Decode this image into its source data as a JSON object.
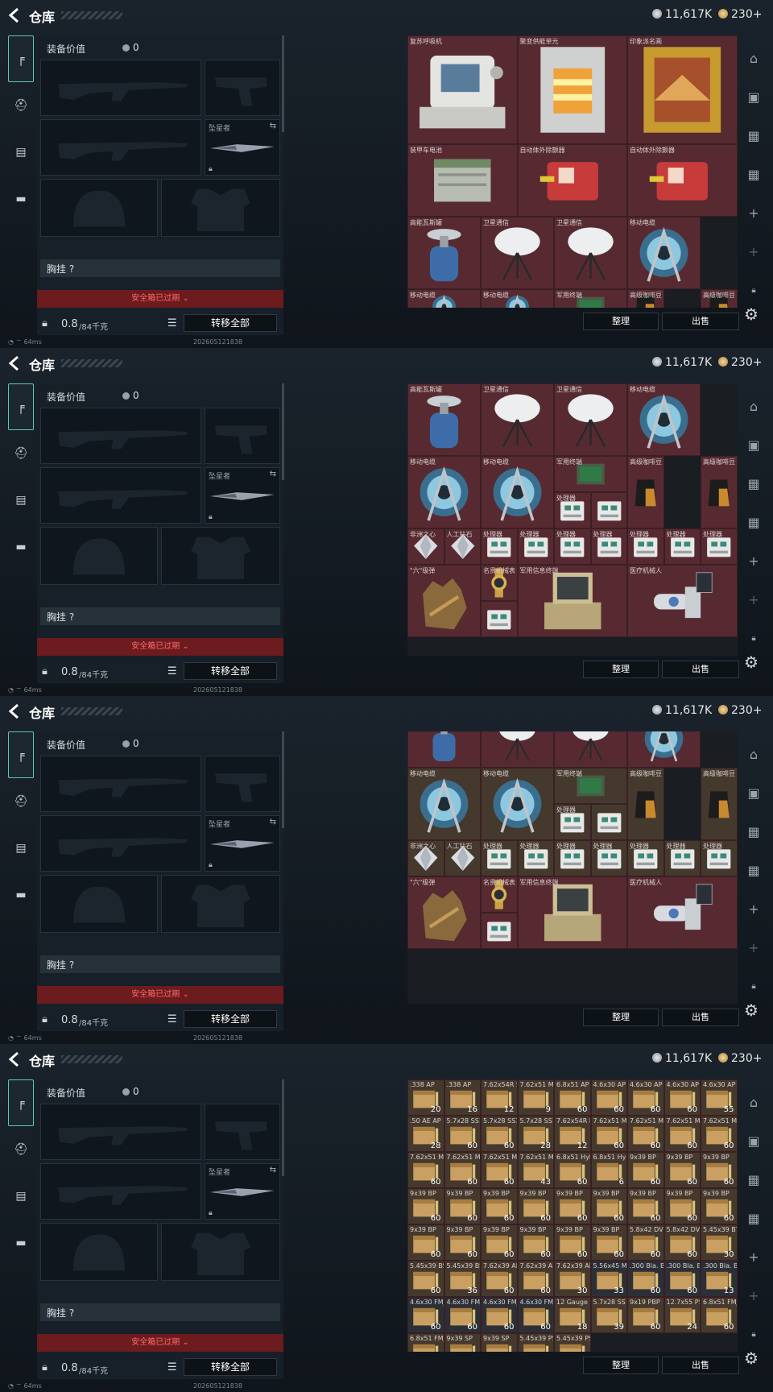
{
  "header": {
    "title": "仓库",
    "currency1": "11,617K",
    "currency2": "230+"
  },
  "gear": {
    "value_label": "装备价值",
    "value": "0",
    "melee_title": "坠星者",
    "chest_label": "胸挂",
    "chest_value": "?",
    "safe_box": "安全箱已过期",
    "weight": "0.8",
    "weight_cap": "/84千克",
    "transfer": "转移全部"
  },
  "buttons": {
    "sort": "整理",
    "sell": "出售"
  },
  "status": {
    "ping": "64ms",
    "build": "202605121838"
  },
  "panels": [
    {
      "cells": [
        {
          "r": 0,
          "c": 0,
          "w": 3,
          "h": 3,
          "name": "复苏呼吸机",
          "icon": "respirator-icon",
          "bg": "red"
        },
        {
          "r": 0,
          "c": 3,
          "w": 3,
          "h": 3,
          "name": "聚变供能单元",
          "icon": "fusion-unit-icon",
          "bg": "red"
        },
        {
          "r": 0,
          "c": 6,
          "w": 3,
          "h": 3,
          "name": "印象派名画",
          "icon": "painting-icon",
          "bg": "red"
        },
        {
          "r": 3,
          "c": 0,
          "w": 3,
          "h": 2,
          "name": "装甲车电池",
          "icon": "battery-icon",
          "bg": "red"
        },
        {
          "r": 3,
          "c": 3,
          "w": 3,
          "h": 2,
          "name": "自动体外除颤器",
          "icon": "defibrillator-icon",
          "bg": "red"
        },
        {
          "r": 3,
          "c": 6,
          "w": 3,
          "h": 2,
          "name": "自动体外除颤器",
          "icon": "defibrillator-icon",
          "bg": "red"
        },
        {
          "r": 5,
          "c": 0,
          "w": 2,
          "h": 2,
          "name": "高能瓦斯罐",
          "icon": "gas-tank-icon",
          "bg": "red"
        },
        {
          "r": 5,
          "c": 2,
          "w": 2,
          "h": 2,
          "name": "卫星通信",
          "icon": "satellite-dish-icon",
          "bg": "red"
        },
        {
          "r": 5,
          "c": 4,
          "w": 2,
          "h": 2,
          "name": "卫星通信",
          "icon": "satellite-dish-icon",
          "bg": "red"
        },
        {
          "r": 5,
          "c": 6,
          "w": 2,
          "h": 2,
          "name": "移动电缆",
          "icon": "cable-reel-icon",
          "bg": "red"
        },
        {
          "r": 7,
          "c": 0,
          "w": 2,
          "h": 1,
          "name": "移动电缆",
          "icon": "cable-reel-icon",
          "bg": "red"
        },
        {
          "r": 7,
          "c": 2,
          "w": 2,
          "h": 1,
          "name": "移动电缆",
          "icon": "cable-reel-icon",
          "bg": "red"
        },
        {
          "r": 7,
          "c": 4,
          "w": 2,
          "h": 1,
          "name": "军用终端",
          "icon": "terminal-icon",
          "bg": "red"
        },
        {
          "r": 7,
          "c": 6,
          "w": 1,
          "h": 1,
          "name": "高级咖啡豆",
          "icon": "coffee-icon",
          "bg": "red"
        },
        {
          "r": 7,
          "c": 8,
          "w": 1,
          "h": 1,
          "name": "高级咖啡豆",
          "icon": "coffee-icon",
          "bg": "red"
        }
      ]
    },
    {
      "cells": [
        {
          "r": 0,
          "c": 0,
          "w": 2,
          "h": 2,
          "name": "高能瓦斯罐",
          "icon": "gas-tank-icon",
          "bg": "red"
        },
        {
          "r": 0,
          "c": 2,
          "w": 2,
          "h": 2,
          "name": "卫星通信",
          "icon": "satellite-dish-icon",
          "bg": "red"
        },
        {
          "r": 0,
          "c": 4,
          "w": 2,
          "h": 2,
          "name": "卫星通信",
          "icon": "satellite-dish-icon",
          "bg": "red"
        },
        {
          "r": 0,
          "c": 6,
          "w": 2,
          "h": 2,
          "name": "移动电缆",
          "icon": "cable-reel-icon",
          "bg": "red"
        },
        {
          "r": 2,
          "c": 0,
          "w": 2,
          "h": 2,
          "name": "移动电缆",
          "icon": "cable-reel-icon",
          "bg": "red"
        },
        {
          "r": 2,
          "c": 2,
          "w": 2,
          "h": 2,
          "name": "移动电缆",
          "icon": "cable-reel-icon",
          "bg": "red"
        },
        {
          "r": 2,
          "c": 4,
          "w": 2,
          "h": 1,
          "name": "军用终端",
          "icon": "terminal-icon",
          "bg": "red"
        },
        {
          "r": 2,
          "c": 6,
          "w": 1,
          "h": 2,
          "name": "高级咖啡豆",
          "icon": "coffee-icon",
          "bg": "red"
        },
        {
          "r": 2,
          "c": 8,
          "w": 1,
          "h": 2,
          "name": "高级咖啡豆",
          "icon": "coffee-icon",
          "bg": "red"
        },
        {
          "r": 3,
          "c": 4,
          "w": 1,
          "h": 1,
          "name": "处理器",
          "icon": "processor-icon",
          "bg": "red"
        },
        {
          "r": 3,
          "c": 5,
          "w": 1,
          "h": 1,
          "name": "",
          "icon": "processor-icon",
          "bg": "red"
        },
        {
          "r": 4,
          "c": 0,
          "w": 1,
          "h": 1,
          "name": "非洲之心",
          "icon": "diamond-icon",
          "bg": "red"
        },
        {
          "r": 4,
          "c": 1,
          "w": 1,
          "h": 1,
          "name": "人工钻石",
          "icon": "diamond-icon",
          "bg": "red"
        },
        {
          "r": 4,
          "c": 2,
          "w": 1,
          "h": 1,
          "name": "处理器",
          "icon": "processor-icon",
          "bg": "red"
        },
        {
          "r": 4,
          "c": 3,
          "w": 1,
          "h": 1,
          "name": "处理器",
          "icon": "processor-icon",
          "bg": "red"
        },
        {
          "r": 4,
          "c": 4,
          "w": 1,
          "h": 1,
          "name": "处理器",
          "icon": "processor-icon",
          "bg": "red"
        },
        {
          "r": 4,
          "c": 5,
          "w": 1,
          "h": 1,
          "name": "处理器",
          "icon": "processor-icon",
          "bg": "red"
        },
        {
          "r": 4,
          "c": 6,
          "w": 1,
          "h": 1,
          "name": "处理器",
          "icon": "processor-icon",
          "bg": "red"
        },
        {
          "r": 4,
          "c": 7,
          "w": 1,
          "h": 1,
          "name": "处理器",
          "icon": "processor-icon",
          "bg": "red"
        },
        {
          "r": 4,
          "c": 8,
          "w": 1,
          "h": 1,
          "name": "处理器",
          "icon": "processor-icon",
          "bg": "red"
        },
        {
          "r": 5,
          "c": 0,
          "w": 2,
          "h": 2,
          "name": "\"六\"级弹",
          "icon": "glove-icon",
          "bg": "red"
        },
        {
          "r": 5,
          "c": 2,
          "w": 1,
          "h": 1,
          "name": "名贵机械表",
          "icon": "watch-icon",
          "bg": "red"
        },
        {
          "r": 6,
          "c": 2,
          "w": 1,
          "h": 1,
          "name": "",
          "icon": "processor-icon",
          "bg": "red"
        },
        {
          "r": 5,
          "c": 3,
          "w": 3,
          "h": 2,
          "name": "军用信息终端",
          "icon": "laptop-case-icon",
          "bg": "red"
        },
        {
          "r": 5,
          "c": 6,
          "w": 3,
          "h": 2,
          "name": "医疗机械人",
          "icon": "robot-arm-icon",
          "bg": "red"
        }
      ]
    },
    {
      "cells": [
        {
          "r": -0.6,
          "c": 0,
          "w": 2,
          "h": 1.6,
          "name": "",
          "icon": "gas-tank-icon",
          "bg": "red"
        },
        {
          "r": -0.6,
          "c": 2,
          "w": 2,
          "h": 1.6,
          "name": "",
          "icon": "satellite-dish-icon",
          "bg": "red"
        },
        {
          "r": -0.6,
          "c": 4,
          "w": 2,
          "h": 1.6,
          "name": "",
          "icon": "satellite-dish-icon",
          "bg": "red"
        },
        {
          "r": -0.6,
          "c": 6,
          "w": 2,
          "h": 1.6,
          "name": "",
          "icon": "cable-reel-icon",
          "bg": "red"
        },
        {
          "r": 1,
          "c": 0,
          "w": 2,
          "h": 2,
          "name": "移动电缆",
          "icon": "cable-reel-icon",
          "bg": "brown"
        },
        {
          "r": 1,
          "c": 2,
          "w": 2,
          "h": 2,
          "name": "移动电缆",
          "icon": "cable-reel-icon",
          "bg": "brown"
        },
        {
          "r": 1,
          "c": 4,
          "w": 2,
          "h": 1,
          "name": "军用终端",
          "icon": "terminal-icon",
          "bg": "brown"
        },
        {
          "r": 1,
          "c": 6,
          "w": 1,
          "h": 2,
          "name": "高级咖啡豆",
          "icon": "coffee-icon",
          "bg": "brown"
        },
        {
          "r": 1,
          "c": 8,
          "w": 1,
          "h": 2,
          "name": "高级咖啡豆",
          "icon": "coffee-icon",
          "bg": "brown"
        },
        {
          "r": 2,
          "c": 4,
          "w": 1,
          "h": 1,
          "name": "处理器",
          "icon": "processor-icon",
          "bg": "brown"
        },
        {
          "r": 2,
          "c": 5,
          "w": 1,
          "h": 1,
          "name": "",
          "icon": "processor-icon",
          "bg": "brown"
        },
        {
          "r": 3,
          "c": 0,
          "w": 1,
          "h": 1,
          "name": "非洲之心",
          "icon": "diamond-icon",
          "bg": "brown"
        },
        {
          "r": 3,
          "c": 1,
          "w": 1,
          "h": 1,
          "name": "人工钻石",
          "icon": "diamond-icon",
          "bg": "brown"
        },
        {
          "r": 3,
          "c": 2,
          "w": 1,
          "h": 1,
          "name": "处理器",
          "icon": "processor-icon",
          "bg": "brown"
        },
        {
          "r": 3,
          "c": 3,
          "w": 1,
          "h": 1,
          "name": "处理器",
          "icon": "processor-icon",
          "bg": "brown"
        },
        {
          "r": 3,
          "c": 4,
          "w": 1,
          "h": 1,
          "name": "处理器",
          "icon": "processor-icon",
          "bg": "brown"
        },
        {
          "r": 3,
          "c": 5,
          "w": 1,
          "h": 1,
          "name": "处理器",
          "icon": "processor-icon",
          "bg": "brown"
        },
        {
          "r": 3,
          "c": 6,
          "w": 1,
          "h": 1,
          "name": "处理器",
          "icon": "processor-icon",
          "bg": "brown"
        },
        {
          "r": 3,
          "c": 7,
          "w": 1,
          "h": 1,
          "name": "处理器",
          "icon": "processor-icon",
          "bg": "brown"
        },
        {
          "r": 3,
          "c": 8,
          "w": 1,
          "h": 1,
          "name": "处理器",
          "icon": "processor-icon",
          "bg": "brown"
        },
        {
          "r": 4,
          "c": 0,
          "w": 2,
          "h": 2,
          "name": "\"六\"级弹",
          "icon": "glove-icon",
          "bg": "red"
        },
        {
          "r": 4,
          "c": 2,
          "w": 1,
          "h": 1,
          "name": "名贵机械表",
          "icon": "watch-icon",
          "bg": "red"
        },
        {
          "r": 5,
          "c": 2,
          "w": 1,
          "h": 1,
          "name": "",
          "icon": "processor-icon",
          "bg": "red"
        },
        {
          "r": 4,
          "c": 3,
          "w": 3,
          "h": 2,
          "name": "军用信息终端",
          "icon": "laptop-case-icon",
          "bg": "red"
        },
        {
          "r": 4,
          "c": 6,
          "w": 3,
          "h": 2,
          "name": "医疗机械人",
          "icon": "robot-arm-icon",
          "bg": "red"
        }
      ]
    },
    {
      "ammo": true,
      "cells": [
        {
          "name": ".338 AP",
          "count": "20",
          "icon": "ammo-box-icon"
        },
        {
          "name": ".338 AP",
          "count": "16",
          "icon": "ammo-box-icon"
        },
        {
          "name": "7.62x54R SNB",
          "count": "12",
          "icon": "ammo-box-icon"
        },
        {
          "name": "7.62x51 M62",
          "count": "9",
          "icon": "ammo-box-icon"
        },
        {
          "name": "6.8x51 AP",
          "count": "60",
          "icon": "ammo-box-icon"
        },
        {
          "name": "4.6x30 AP",
          "count": "60",
          "icon": "ammo-box-icon"
        },
        {
          "name": "4.6x30 AP",
          "count": "60",
          "icon": "ammo-box-icon"
        },
        {
          "name": "4.6x30 AP",
          "count": "60",
          "icon": "ammo-box-icon"
        },
        {
          "name": "4.6x30 AP",
          "count": "55",
          "icon": "ammo-box-icon"
        },
        {
          "name": ".50 AE AP",
          "count": "28",
          "icon": "ammo-box-icon"
        },
        {
          "name": "5.7x28 SS190",
          "count": "60",
          "icon": "ammo-box-icon"
        },
        {
          "name": "5.7x28 SS190",
          "count": "60",
          "icon": "ammo-box-icon"
        },
        {
          "name": "5.7x28 SS190",
          "count": "28",
          "icon": "ammo-box-icon"
        },
        {
          "name": "7.62x54R LPS",
          "count": "12",
          "icon": "ammo-box-icon"
        },
        {
          "name": "7.62x51 M61",
          "count": "60",
          "icon": "ammo-box-icon"
        },
        {
          "name": "7.62x51 M61",
          "count": "60",
          "icon": "ammo-box-icon"
        },
        {
          "name": "7.62x51 M61",
          "count": "60",
          "icon": "ammo-box-icon"
        },
        {
          "name": "7.62x51 M61",
          "count": "60",
          "icon": "ammo-box-icon"
        },
        {
          "name": "7.62x51 M80",
          "count": "60",
          "icon": "ammo-box-icon"
        },
        {
          "name": "7.62x51 M80",
          "count": "60",
          "icon": "ammo-box-icon"
        },
        {
          "name": "7.62x51 M80",
          "count": "60",
          "icon": "ammo-box-icon"
        },
        {
          "name": "7.62x51 M80",
          "count": "43",
          "icon": "ammo-box-icon"
        },
        {
          "name": "6.8x51 Hybrid",
          "count": "60",
          "icon": "ammo-box-icon"
        },
        {
          "name": "6.8x51 Hybrid",
          "count": "6",
          "icon": "ammo-box-icon"
        },
        {
          "name": "9x39 BP",
          "count": "60",
          "icon": "ammo-box-icon"
        },
        {
          "name": "9x39 BP",
          "count": "60",
          "icon": "ammo-box-icon"
        },
        {
          "name": "9x39 BP",
          "count": "60",
          "icon": "ammo-box-icon"
        },
        {
          "name": "9x39 BP",
          "count": "60",
          "icon": "ammo-box-icon"
        },
        {
          "name": "9x39 BP",
          "count": "60",
          "icon": "ammo-box-icon"
        },
        {
          "name": "9x39 BP",
          "count": "60",
          "icon": "ammo-box-icon"
        },
        {
          "name": "9x39 BP",
          "count": "60",
          "icon": "ammo-box-icon"
        },
        {
          "name": "9x39 BP",
          "count": "60",
          "icon": "ammo-box-icon"
        },
        {
          "name": "9x39 BP",
          "count": "60",
          "icon": "ammo-box-icon"
        },
        {
          "name": "9x39 BP",
          "count": "60",
          "icon": "ammo-box-icon"
        },
        {
          "name": "9x39 BP",
          "count": "60",
          "icon": "ammo-box-icon"
        },
        {
          "name": "9x39 BP",
          "count": "60",
          "icon": "ammo-box-icon"
        },
        {
          "name": "9x39 BP",
          "count": "60",
          "icon": "ammo-box-icon"
        },
        {
          "name": "9x39 BP",
          "count": "60",
          "icon": "ammo-box-icon"
        },
        {
          "name": "9x39 BP",
          "count": "60",
          "icon": "ammo-box-icon"
        },
        {
          "name": "9x39 BP",
          "count": "60",
          "icon": "ammo-box-icon"
        },
        {
          "name": "9x39 BP",
          "count": "60",
          "icon": "ammo-box-icon"
        },
        {
          "name": "9x39 BP",
          "count": "60",
          "icon": "ammo-box-icon"
        },
        {
          "name": "5.8x42 DVC12",
          "count": "60",
          "icon": "ammo-box-icon"
        },
        {
          "name": "5.8x42 DVC12",
          "count": "60",
          "icon": "ammo-box-icon"
        },
        {
          "name": "5.45x39 BT",
          "count": "30",
          "icon": "ammo-box-icon"
        },
        {
          "name": "5.45x39 BS",
          "count": "60",
          "icon": "ammo-box-icon"
        },
        {
          "name": "5.45x39 BS",
          "count": "36",
          "icon": "ammo-box-icon"
        },
        {
          "name": "7.62x39 AP",
          "count": "60",
          "icon": "ammo-box-icon"
        },
        {
          "name": "7.62x39 AP",
          "count": "60",
          "icon": "ammo-box-icon"
        },
        {
          "name": "7.62x39 AP",
          "count": "30",
          "icon": "ammo-box-icon"
        },
        {
          "name": "5.56x45 M995",
          "count": "33",
          "icon": "ammo-box-icon"
        },
        {
          "name": ".300 Bla. BP",
          "count": "60",
          "icon": "ammo-box-icon"
        },
        {
          "name": ".300 Bla. BP",
          "count": "60",
          "icon": "ammo-box-icon"
        },
        {
          "name": ".300 Bla. BP",
          "count": "13",
          "icon": "ammo-box-icon"
        },
        {
          "name": "4.6x30 FMJ",
          "count": "60",
          "icon": "ammo-box-icon"
        },
        {
          "name": "4.6x30 FMJ",
          "count": "60",
          "icon": "ammo-box-icon"
        },
        {
          "name": "4.6x30 FMJ",
          "count": "60",
          "icon": "ammo-box-icon"
        },
        {
          "name": "4.6x30 FMJ",
          "count": "60",
          "icon": "ammo-box-icon"
        },
        {
          "name": "12 Gauge Slug",
          "count": "18",
          "icon": "ammo-box-icon"
        },
        {
          "name": "5.7x28 SS197",
          "count": "39",
          "icon": "ammo-box-icon"
        },
        {
          "name": "9x19 PBP",
          "count": "60",
          "icon": "ammo-box-icon"
        },
        {
          "name": "12.7x55 PS12B",
          "count": "24",
          "icon": "ammo-box-icon"
        },
        {
          "name": "6.8x51 FMJ",
          "count": "60",
          "icon": "ammo-box-icon"
        },
        {
          "name": "6.8x51 FMJ",
          "count": "",
          "icon": "ammo-box-icon"
        },
        {
          "name": "9x39 SP",
          "count": "",
          "icon": "ammo-box-icon"
        },
        {
          "name": "9x39 SP",
          "count": "",
          "icon": "ammo-box-icon"
        },
        {
          "name": "5.45x39 PS",
          "count": "",
          "icon": "ammo-box-icon"
        },
        {
          "name": "5.45x39 PS",
          "count": "",
          "icon": "ammo-box-icon"
        }
      ]
    }
  ]
}
